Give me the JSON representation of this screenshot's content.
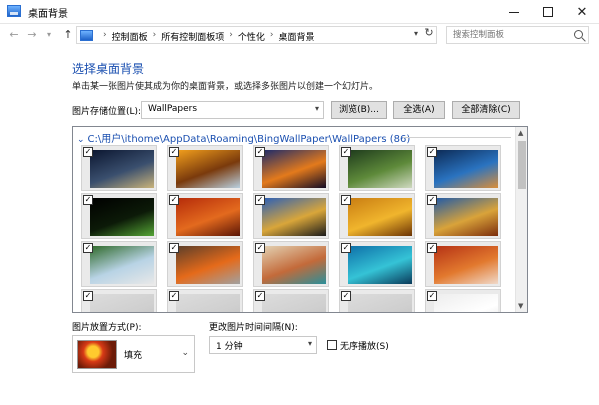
{
  "window": {
    "title": "桌面背景"
  },
  "address": {
    "crumbs": [
      "控制面板",
      "所有控制面板项",
      "个性化",
      "桌面背景"
    ],
    "search_placeholder": "搜索控制面板"
  },
  "page": {
    "heading": "选择桌面背景",
    "description": "单击某一张图片使其成为你的桌面背景，或选择多张图片以创建一个幻灯片。",
    "location_label": "图片存储位置(L):",
    "location_value": "WallPapers",
    "browse_label": "浏览(B)...",
    "select_all_label": "全选(A)",
    "clear_all_label": "全部清除(C)"
  },
  "gallery": {
    "folder_path": "C:\\用户\\ithome\\AppData\\Roaming\\BingWallPaper\\WallPapers (86)",
    "tiles": [
      {
        "checked": true,
        "colors": [
          "#0b1630",
          "#3a4f6e",
          "#c9b37a"
        ]
      },
      {
        "checked": true,
        "colors": [
          "#f3a01d",
          "#7a3a0c",
          "#b9d0e0"
        ]
      },
      {
        "checked": true,
        "colors": [
          "#1b2a6b",
          "#e37a1c",
          "#120b24"
        ]
      },
      {
        "checked": true,
        "colors": [
          "#1e3b1c",
          "#5e8a3a",
          "#cfd9c0"
        ]
      },
      {
        "checked": true,
        "colors": [
          "#0c2a55",
          "#2a73c0",
          "#d98e3a"
        ]
      },
      {
        "checked": true,
        "colors": [
          "#000000",
          "#0c1a08",
          "#55a535"
        ]
      },
      {
        "checked": true,
        "colors": [
          "#b52b0a",
          "#e36a1e",
          "#5a1506"
        ]
      },
      {
        "checked": true,
        "colors": [
          "#2a5fb8",
          "#d9a63a",
          "#1b1b1b"
        ]
      },
      {
        "checked": true,
        "colors": [
          "#c97d12",
          "#f0b52d",
          "#6b3305"
        ]
      },
      {
        "checked": true,
        "colors": [
          "#1f5aa8",
          "#d9a33a",
          "#7c2d0c"
        ]
      },
      {
        "checked": true,
        "colors": [
          "#2f6a2a",
          "#b8d3e5",
          "#e8e8e8"
        ]
      },
      {
        "checked": true,
        "colors": [
          "#5b3e2a",
          "#e56a1a",
          "#a1a1a1"
        ]
      },
      {
        "checked": true,
        "colors": [
          "#e3d2b3",
          "#c36a3a",
          "#2a8f9a"
        ]
      },
      {
        "checked": true,
        "colors": [
          "#0e6fa8",
          "#35c3d6",
          "#0a3a5a"
        ]
      },
      {
        "checked": true,
        "colors": [
          "#b53215",
          "#e2792e",
          "#f0d9c9"
        ]
      },
      {
        "checked": true,
        "colors": [
          "#dcdcdc",
          "#cfcfcf",
          "#bdbdbd"
        ]
      },
      {
        "checked": true,
        "colors": [
          "#dcdcdc",
          "#cfcfcf",
          "#bdbdbd"
        ]
      },
      {
        "checked": true,
        "colors": [
          "#dcdcdc",
          "#cfcfcf",
          "#bdbdbd"
        ]
      },
      {
        "checked": true,
        "colors": [
          "#dcdcdc",
          "#cfcfcf",
          "#bdbdbd"
        ]
      },
      {
        "checked": true,
        "colors": [
          "#ededed",
          "#ffffff",
          "#d9d9d9"
        ]
      }
    ]
  },
  "position": {
    "label": "图片放置方式(P):",
    "value": "填充"
  },
  "interval": {
    "label": "更改图片时间间隔(N):",
    "value": "1 分钟"
  },
  "shuffle": {
    "label": "无序播放(S)",
    "checked": false
  }
}
